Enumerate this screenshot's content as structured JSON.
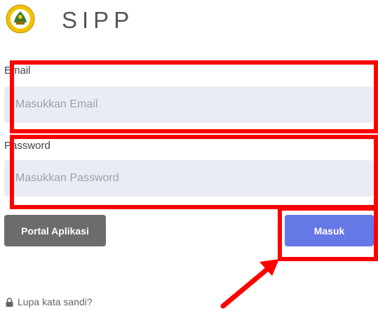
{
  "header": {
    "logo_icon": "emblem-logo-icon",
    "app_title": "SIPP"
  },
  "form": {
    "email_label": "Email",
    "email_placeholder": "Masukkan Email",
    "email_value": "",
    "password_label": "Password",
    "password_placeholder": "Masukkan Password",
    "password_value": ""
  },
  "actions": {
    "portal_label": "Portal Aplikasi",
    "submit_label": "Masuk",
    "forgot_label": "Lupa kata sandi?",
    "forgot_icon": "lock-icon"
  },
  "annotation": {
    "color": "#ff0000",
    "arrow_icon": "arrow-icon"
  }
}
